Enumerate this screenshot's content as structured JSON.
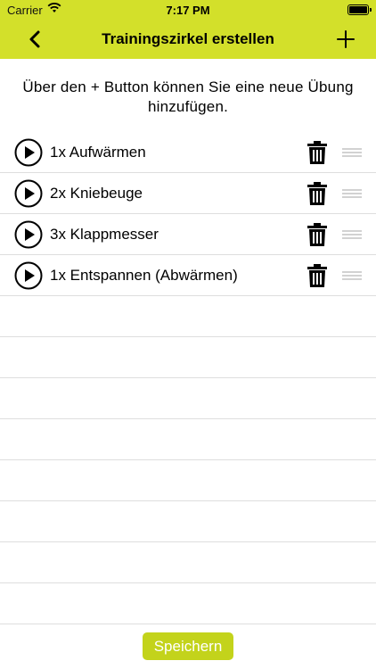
{
  "status_bar": {
    "carrier": "Carrier",
    "time": "7:17 PM"
  },
  "nav": {
    "title": "Trainingszirkel erstellen",
    "back_icon": "chevron-left-icon",
    "add_icon": "plus-icon"
  },
  "hint": "Über den + Button können Sie eine neue Übung hinzufügen.",
  "exercises": [
    {
      "label": "1x Aufwärmen"
    },
    {
      "label": "2x Kniebeuge"
    },
    {
      "label": "3x Klappmesser"
    },
    {
      "label": "1x Entspannen (Abwärmen)"
    }
  ],
  "save_label": "Speichern",
  "colors": {
    "header": "#d3e02a",
    "save_button": "#c3d31b",
    "separator": "#dedede"
  }
}
